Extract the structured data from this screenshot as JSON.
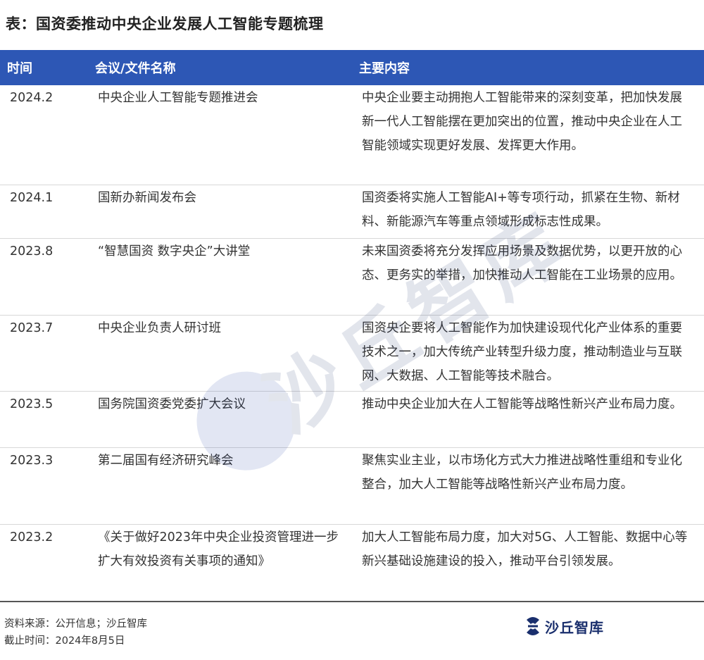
{
  "title": "表：国资委推动中央企业发展人工智能专题梳理",
  "table": {
    "headers": [
      "时间",
      "会议/文件名称",
      "主要内容"
    ],
    "rows": [
      {
        "time": "2024.2",
        "name": "中央企业人工智能专题推进会",
        "content": "中央企业要主动拥抱人工智能带来的深刻变革，把加快发展新一代人工智能摆在更加突出的位置，推动中央企业在人工智能领域实现更好发展、发挥更大作用。"
      },
      {
        "time": "2024.1",
        "name": "国新办新闻发布会",
        "content": "国资委将实施人工智能AI+等专项行动，抓紧在生物、新材料、新能源汽车等重点领域形成标志性成果。"
      },
      {
        "time": "2023.8",
        "name": "“智慧国资 数字央企”大讲堂",
        "content": "未来国资委将充分发挥应用场景及数据优势，以更开放的心态、更务实的举措，加快推动人工智能在工业场景的应用。"
      },
      {
        "time": "2023.7",
        "name": "中央企业负责人研讨班",
        "content": "国资央企要将人工智能作为加快建设现代化产业体系的重要技术之一，加大传统产业转型升级力度，推动制造业与互联网、大数据、人工智能等技术融合。"
      },
      {
        "time": "2023.5",
        "name": "国务院国资委党委扩大会议",
        "content": "推动中央企业加大在人工智能等战略性新兴产业布局力度。"
      },
      {
        "time": "2023.3",
        "name": "第二届国有经济研究峰会",
        "content": "聚焦实业主业，以市场化方式大力推进战略性重组和专业化整合，加大人工智能等战略性新兴产业布局力度。"
      },
      {
        "time": "2023.2",
        "name": "《关于做好2023年中央企业投资管理进一步扩大有效投资有关事项的通知》",
        "content": "加大人工智能布局力度，加大对5G、人工智能、数据中心等新兴基础设施建设的投入，推动平台引领发展。"
      }
    ]
  },
  "footer": {
    "source": "资料来源：公开信息；沙丘智库",
    "date": "截止时间：2024年8月5日"
  },
  "logo": {
    "text": "沙丘智库",
    "color": "#1a2f6d"
  },
  "watermark": {
    "text": "沙丘智库"
  },
  "colors": {
    "header_bg": "#2d57b5",
    "header_text": "#ffffff"
  }
}
